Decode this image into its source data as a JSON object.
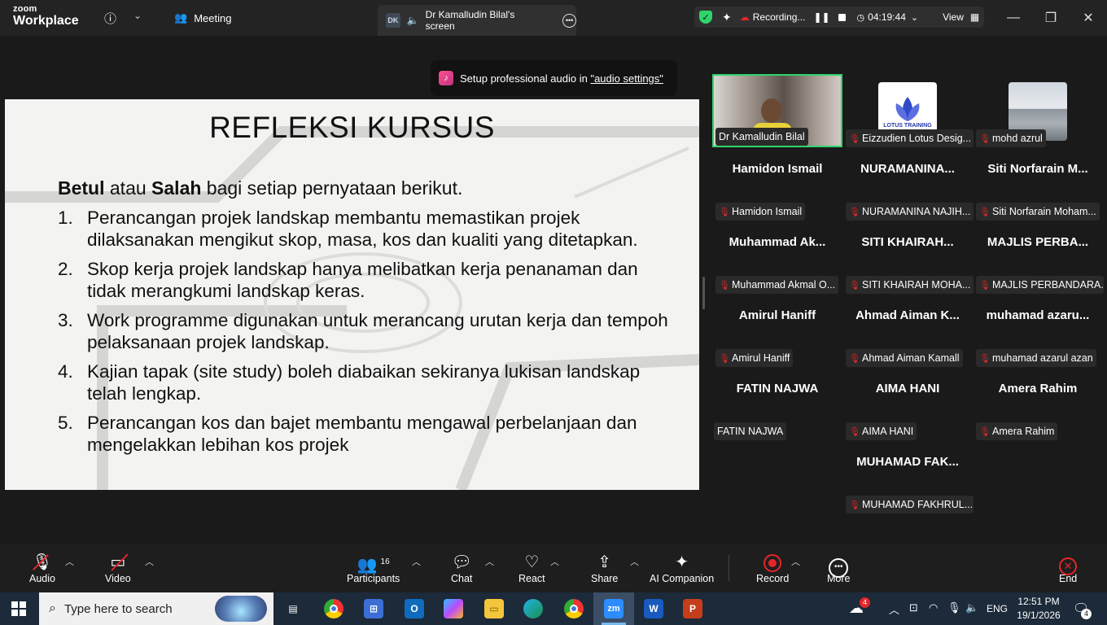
{
  "app": {
    "brand_small": "zoom",
    "brand_large": "Workplace",
    "meeting_label": "Meeting"
  },
  "share_tab": {
    "badge": "DK",
    "title": "Dr Kamalludin Bilal's screen"
  },
  "status": {
    "recording_label": "Recording...",
    "timer": "04:19:44",
    "view_label": "View"
  },
  "tooltip": {
    "prefix": "Setup professional audio in ",
    "link": "\"audio settings\""
  },
  "slide": {
    "title": "REFLEKSI KURSUS",
    "intro_bold1": "Betul",
    "intro_mid": " atau ",
    "intro_bold2": "Salah",
    "intro_end": " bagi setiap pernyataan berikut.",
    "items": [
      {
        "n": "1.",
        "text": "Perancangan projek landskap membantu memastikan projek dilaksanakan mengikut skop, masa, kos dan kualiti yang ditetapkan."
      },
      {
        "n": "2.",
        "text": "Skop kerja projek landskap hanya melibatkan kerja penanaman dan tidak merangkumi landskap keras."
      },
      {
        "n": "3.",
        "text": "Work programme digunakan untuk merancang urutan kerja dan tempoh pelaksanaan projek landskap."
      },
      {
        "n": "4.",
        "text": "Kajian tapak (site study) boleh diabaikan sekiranya lukisan landskap telah lengkap."
      },
      {
        "n": "5.",
        "text": "Perancangan kos dan bajet membantu mengawal perbelanjaan dan mengelakkan lebihan kos projek"
      }
    ]
  },
  "gallery": {
    "video_tiles": [
      {
        "badge": "Dr Kamalludin Bilal",
        "muted": false
      },
      {
        "badge": "Eizzudien Lotus Desig...",
        "muted": true,
        "logo_text": "LOTUS TRAINING"
      },
      {
        "badge": "mohd azrul",
        "muted": true
      }
    ],
    "name_tiles": [
      {
        "big": "Hamidon Ismail",
        "badge": "Hamidon Ismail",
        "muted": true
      },
      {
        "big": "NURAMANINA...",
        "badge": "NURAMANINA NAJIH...",
        "muted": true
      },
      {
        "big": "Siti  Norfarain  M...",
        "badge": "Siti Norfarain Moham...",
        "muted": true
      },
      {
        "big": "Muhammad  Ak...",
        "badge": "Muhammad Akmal O...",
        "muted": true
      },
      {
        "big": "SITI  KHAIRAH...",
        "badge": "SITI KHAIRAH MOHA...",
        "muted": true
      },
      {
        "big": "MAJLIS  PERBA...",
        "badge": "MAJLIS PERBANDARA...",
        "muted": true
      },
      {
        "big": "Amirul Haniff",
        "badge": "Amirul Haniff",
        "muted": true
      },
      {
        "big": "Ahmad Aiman K...",
        "badge": "Ahmad Aiman Kamall",
        "muted": true
      },
      {
        "big": "muhamad  azaru...",
        "badge": "muhamad azarul azan",
        "muted": true
      },
      {
        "big": "FATIN NAJWA",
        "badge": "FATIN NAJWA",
        "muted": false
      },
      {
        "big": "AIMA HANI",
        "badge": "AIMA HANI",
        "muted": true
      },
      {
        "big": "Amera Rahim",
        "badge": "Amera Rahim",
        "muted": true
      },
      {
        "big": "MUHAMAD  FAK...",
        "badge": "MUHAMAD FAKHRUL...",
        "muted": true
      }
    ]
  },
  "toolbar": {
    "audio": "Audio",
    "video": "Video",
    "participants": "Participants",
    "participants_count": "16",
    "chat": "Chat",
    "react": "React",
    "share": "Share",
    "ai": "AI Companion",
    "record": "Record",
    "more": "More",
    "end": "End"
  },
  "taskbar": {
    "search_placeholder": "Type here to search",
    "lang": "ENG",
    "time": "12:51 PM",
    "date": "19/1/2026",
    "weather_badge": "4",
    "notif_count": "4"
  },
  "colors": {
    "accent_green": "#2ed46a",
    "muted_red": "#e02828",
    "record_red": "#e5252a"
  }
}
